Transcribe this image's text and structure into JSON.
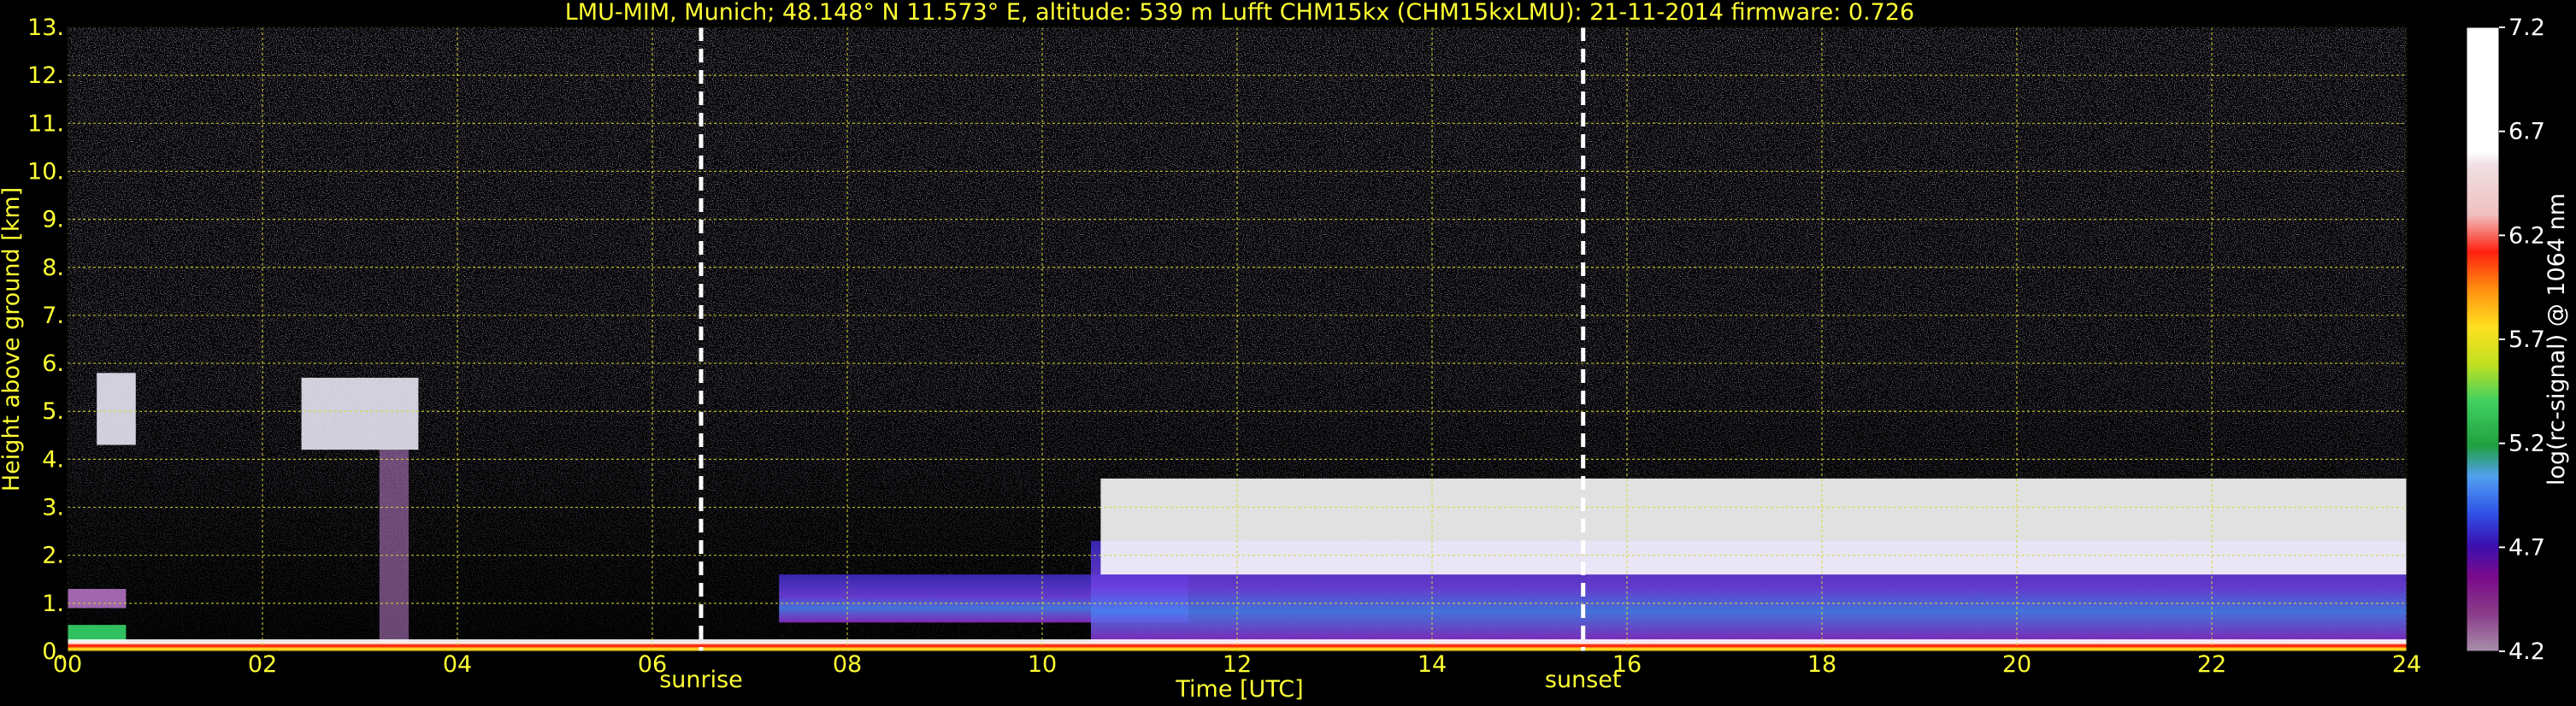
{
  "chart_data": {
    "type": "heatmap",
    "title": "LMU-MIM, Munich; 48.148° N 11.573° E, altitude: 539 m    Lufft CHM15kx (CHM15kxLMU): 21-11-2014    firmware: 0.726",
    "xlabel": "Time [UTC]",
    "ylabel": "Height above ground [km]",
    "xlim": [
      0,
      24
    ],
    "ylim": [
      0,
      13
    ],
    "x_ticks": [
      "00",
      "02",
      "04",
      "06",
      "08",
      "10",
      "12",
      "14",
      "16",
      "18",
      "20",
      "22",
      "24"
    ],
    "y_ticks": [
      "0.",
      "1.",
      "2.",
      "3.",
      "4.",
      "5.",
      "6.",
      "7.",
      "8.",
      "9.",
      "10.",
      "11.",
      "12.",
      "13."
    ],
    "grid": true,
    "markers": [
      {
        "label": "sunrise",
        "time": 6.5
      },
      {
        "label": "sunset",
        "time": 15.55
      }
    ],
    "colorbar": {
      "label": "log(rc-signal) @ 1064 nm",
      "range": [
        4.2,
        7.2
      ],
      "ticks": [
        "4.2",
        "4.7",
        "5.2",
        "5.7",
        "6.2",
        "6.7",
        "7.2"
      ]
    },
    "features": [
      {
        "name": "near-surface layer",
        "t0": 0,
        "t1": 24,
        "h0": 0,
        "h1": 0.2
      },
      {
        "name": "residual aerosol layer",
        "t0": 0,
        "t1": 0.6,
        "h0": 0.2,
        "h1": 0.55
      },
      {
        "name": "elevated layer",
        "t0": 0,
        "t1": 0.6,
        "h0": 0.9,
        "h1": 1.3
      },
      {
        "name": "mid-level cloud",
        "t0": 0.3,
        "t1": 0.7,
        "h0": 4.3,
        "h1": 5.8
      },
      {
        "name": "mid-level cloud",
        "t0": 2.4,
        "t1": 3.6,
        "h0": 4.2,
        "h1": 5.7
      },
      {
        "name": "precipitation streak",
        "t0": 3.2,
        "t1": 3.5,
        "h0": 0.1,
        "h1": 4.2
      },
      {
        "name": "boundary layer",
        "t0": 7.3,
        "t1": 11.5,
        "h0": 0.6,
        "h1": 1.6
      },
      {
        "name": "stratocumulus deck",
        "t0": 10.6,
        "t1": 24,
        "h0": 1.6,
        "h1": 3.6
      },
      {
        "name": "boundary layer",
        "t0": 10.5,
        "t1": 24,
        "h0": 0.2,
        "h1": 2.3
      }
    ]
  }
}
